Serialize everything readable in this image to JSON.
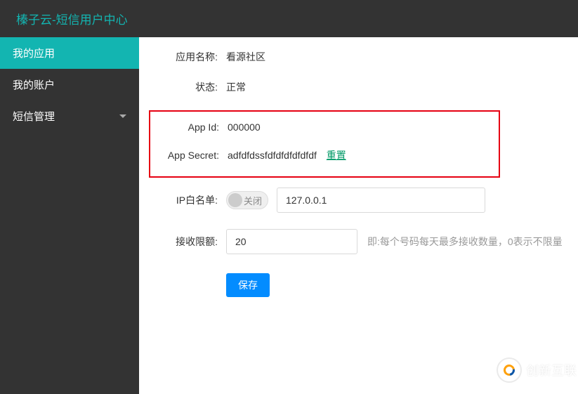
{
  "header": {
    "title": "榛子云-短信用户中心"
  },
  "sidebar": {
    "items": [
      {
        "label": "我的应用",
        "active": true
      },
      {
        "label": "我的账户",
        "active": false
      },
      {
        "label": "短信管理",
        "active": false,
        "hasChevron": true
      }
    ]
  },
  "form": {
    "appNameLabel": "应用名称:",
    "appNameValue": "看源社区",
    "statusLabel": "状态:",
    "statusValue": "正常",
    "appIdLabel": "App Id:",
    "appIdValue": "000000",
    "appSecretLabel": "App Secret:",
    "appSecretValue": "adfdfdssfdfdfdfdfdfdf",
    "resetLabel": "重置",
    "ipWhitelistLabel": "IP白名单:",
    "toggleLabel": "关闭",
    "ipValue": "127.0.0.1",
    "limitLabel": "接收限额:",
    "limitValue": "20",
    "limitHint": "即:每个号码每天最多接收数量，0表示不限量",
    "saveLabel": "保存"
  },
  "watermark": {
    "text": "创新互联"
  }
}
